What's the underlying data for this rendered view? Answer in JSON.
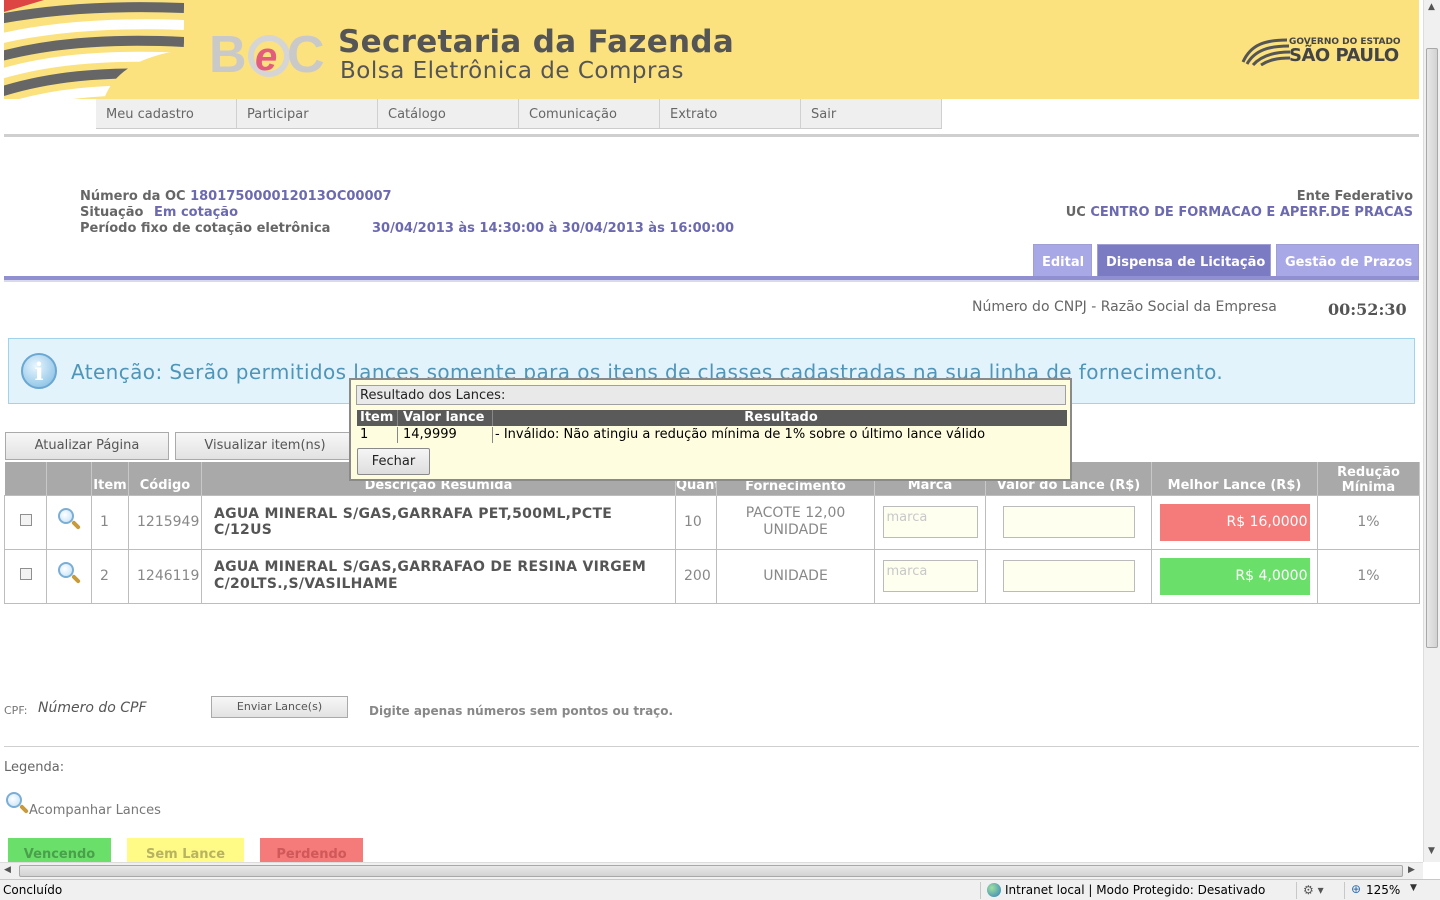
{
  "header": {
    "logo_text": "BEC",
    "title": "Secretaria da Fazenda",
    "subtitle": "Bolsa Eletrônica de Compras",
    "gov_line1": "GOVERNO DO ESTADO",
    "gov_line2": "SÃO PAULO"
  },
  "nav": [
    "Meu cadastro",
    "Participar",
    "Catálogo",
    "Comunicação",
    "Extrato",
    "Sair"
  ],
  "oc": {
    "numero_label": "Número da OC",
    "numero_value": "180175000012013OC00007",
    "situacao_label": "Situação",
    "situacao_value": "Em cotação",
    "periodo_label": "Período fixo de cotação eletrônica",
    "periodo_value": "30/04/2013 às 14:30:00 à 30/04/2013 às 16:00:00",
    "ente_label": "Ente Federativo",
    "uc_label": "UC",
    "uc_value": "CENTRO DE FORMACAO E APERF.DE PRACAS"
  },
  "tabs": [
    "Edital",
    "Dispensa de Licitação",
    "Gestão de Prazos"
  ],
  "cnpj_label": "Número do CNPJ - Razão Social da Empresa",
  "timer": "00:52:30",
  "attention": "Atenção: Serão permitidos lances somente para os itens de classes cadastradas na sua linha de fornecimento.",
  "actions": {
    "atualizar": "Atualizar Página",
    "visualizar": "Visualizar item(ns)"
  },
  "table": {
    "headers": [
      "",
      "",
      "Item",
      "Código",
      "Descrição Resumida",
      "Quant.",
      "Unidade de Fornecimento",
      "Marca",
      "Valor do Lance (R$)",
      "Melhor Lance (R$)",
      "Redução Mínima"
    ],
    "rows": [
      {
        "item": "1",
        "codigo": "1215949",
        "descricao": "AGUA MINERAL S/GAS,GARRAFA PET,500ML,PCTE C/12US",
        "quant": "10",
        "unidade": "PACOTE 12,00 UNIDADE",
        "marca_placeholder": "marca",
        "valor_lance": "",
        "melhor_lance": "R$ 16,0000",
        "melhor_color": "#f57a7a",
        "reducao": "1%"
      },
      {
        "item": "2",
        "codigo": "1246119",
        "descricao": "AGUA MINERAL S/GAS,GARRAFAO DE RESINA VIRGEM C/20LTS.,S/VASILHAME",
        "quant": "200",
        "unidade": "UNIDADE",
        "marca_placeholder": "marca",
        "valor_lance": "",
        "melhor_lance": "R$ 4,0000",
        "melhor_color": "#6ae06a",
        "reducao": "1%"
      }
    ]
  },
  "modal": {
    "title": "Resultado dos Lances:",
    "col_item": "Item",
    "col_valor": "Valor lance",
    "col_resultado": "Resultado",
    "row_item": "1",
    "row_valor": "14,9999",
    "row_resultado": "- Inválido: Não atingiu a redução mínima de 1% sobre o último lance válido",
    "close_label": "Fechar"
  },
  "bottom": {
    "cpf_label": "CPF:",
    "cpf_placeholder": "Número do CPF",
    "enviar_label": "Enviar Lance(s)",
    "hint": "Digite apenas números sem pontos ou traço.",
    "legenda_label": "Legenda:",
    "acompanhar": "Acompanhar Lances",
    "vencendo": "Vencendo",
    "sem_lance": "Sem Lance",
    "perdendo": "Perdendo"
  },
  "statusbar": {
    "status": "Concluído",
    "zone": "Intranet local | Modo Protegido: Desativado",
    "zoom": "125%"
  },
  "colors": {
    "header_bg": "#fbe27e",
    "accent_purple": "#6b69b0",
    "winning": "#6ae06a",
    "no_bid": "#fffb86",
    "losing": "#f57a7a"
  }
}
